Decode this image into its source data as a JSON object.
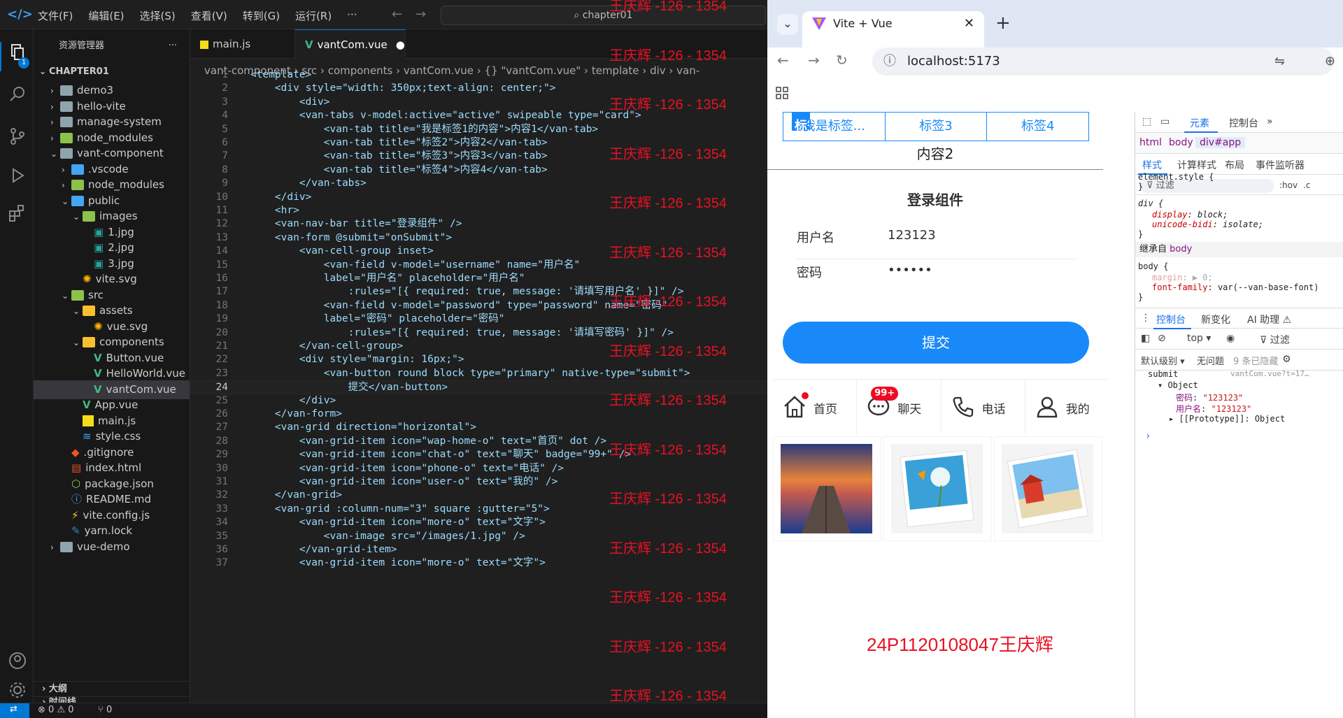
{
  "vscode": {
    "menus": [
      "文件(F)",
      "编辑(E)",
      "选择(S)",
      "查看(V)",
      "转到(G)",
      "运行(R)",
      "···"
    ],
    "search_text": "chapter01",
    "explorer_title": "资源管理器",
    "explorer_badge": "1",
    "root_folder": "CHAPTER01",
    "tree": [
      {
        "label": "demo3",
        "kind": "folder",
        "depth": 1,
        "open": false
      },
      {
        "label": "hello-vite",
        "kind": "folder",
        "depth": 1,
        "open": false
      },
      {
        "label": "manage-system",
        "kind": "folder",
        "depth": 1,
        "open": false
      },
      {
        "label": "node_modules",
        "kind": "folder-g",
        "depth": 1,
        "open": false
      },
      {
        "label": "vant-component",
        "kind": "folder",
        "depth": 1,
        "open": true
      },
      {
        "label": ".vscode",
        "kind": "folder-b",
        "depth": 2,
        "open": false
      },
      {
        "label": "node_modules",
        "kind": "folder-g",
        "depth": 2,
        "open": false
      },
      {
        "label": "public",
        "kind": "folder-b",
        "depth": 2,
        "open": true
      },
      {
        "label": "images",
        "kind": "folder-g",
        "depth": 3,
        "open": true
      },
      {
        "label": "1.jpg",
        "kind": "img",
        "depth": 4
      },
      {
        "label": "2.jpg",
        "kind": "img",
        "depth": 4
      },
      {
        "label": "3.jpg",
        "kind": "img",
        "depth": 4
      },
      {
        "label": "vite.svg",
        "kind": "svg",
        "depth": 3
      },
      {
        "label": "src",
        "kind": "folder-g",
        "depth": 2,
        "open": true
      },
      {
        "label": "assets",
        "kind": "folder-y",
        "depth": 3,
        "open": true
      },
      {
        "label": "vue.svg",
        "kind": "svg",
        "depth": 4
      },
      {
        "label": "components",
        "kind": "folder-y",
        "depth": 3,
        "open": true
      },
      {
        "label": "Button.vue",
        "kind": "vue",
        "depth": 4
      },
      {
        "label": "HelloWorld.vue",
        "kind": "vue",
        "depth": 4
      },
      {
        "label": "vantCom.vue",
        "kind": "vue",
        "depth": 4,
        "selected": true
      },
      {
        "label": "App.vue",
        "kind": "vue",
        "depth": 3
      },
      {
        "label": "main.js",
        "kind": "js",
        "depth": 3
      },
      {
        "label": "style.css",
        "kind": "css",
        "depth": 3
      },
      {
        "label": ".gitignore",
        "kind": "git",
        "depth": 2
      },
      {
        "label": "index.html",
        "kind": "html",
        "depth": 2
      },
      {
        "label": "package.json",
        "kind": "json",
        "depth": 2
      },
      {
        "label": "README.md",
        "kind": "info",
        "depth": 2
      },
      {
        "label": "vite.config.js",
        "kind": "vite",
        "depth": 2
      },
      {
        "label": "yarn.lock",
        "kind": "yarn",
        "depth": 2
      },
      {
        "label": "vue-demo",
        "kind": "folder",
        "depth": 1,
        "open": false
      }
    ],
    "outline_label": "大纲",
    "timeline_label": "时间线",
    "tabs": [
      {
        "label": "main.js"
      },
      {
        "label": "vantCom.vue",
        "active": true
      }
    ],
    "breadcrumb": "vant-component › src › components › vantCom.vue › {} \"vantCom.vue\" › template › div › van-",
    "code_lines": [
      "<template>",
      "    <div style=\"width: 350px;text-align: center;\">",
      "        <div>",
      "        <van-tabs v-model:active=\"active\" swipeable type=\"card\">",
      "            <van-tab title=\"我是标签1的内容\">内容1</van-tab>",
      "            <van-tab title=\"标签2\">内容2</van-tab>",
      "            <van-tab title=\"标签3\">内容3</van-tab>",
      "            <van-tab title=\"标签4\">内容4</van-tab>",
      "        </van-tabs>",
      "    </div>",
      "    <hr>",
      "    <van-nav-bar title=\"登录组件\" />",
      "    <van-form @submit=\"onSubmit\">",
      "        <van-cell-group inset>",
      "            <van-field v-model=\"username\" name=\"用户名\"",
      "            label=\"用户名\" placeholder=\"用户名\"",
      "                :rules=\"[{ required: true, message: '请填写用户名' }]\" />",
      "            <van-field v-model=\"password\" type=\"password\" name=\"密码\"",
      "            label=\"密码\" placeholder=\"密码\"",
      "                :rules=\"[{ required: true, message: '请填写密码' }]\" />",
      "        </van-cell-group>",
      "        <div style=\"margin: 16px;\">",
      "            <van-button round block type=\"primary\" native-type=\"submit\">",
      "                提交</van-button>",
      "        </div>",
      "    </van-form>",
      "    <van-grid direction=\"horizontal\">",
      "        <van-grid-item icon=\"wap-home-o\" text=\"首页\" dot />",
      "        <van-grid-item icon=\"chat-o\" text=\"聊天\" badge=\"99+\" />",
      "        <van-grid-item icon=\"phone-o\" text=\"电话\" />",
      "        <van-grid-item icon=\"user-o\" text=\"我的\" />",
      "    </van-grid>",
      "    <van-grid :column-num=\"3\" square :gutter=\"5\">",
      "        <van-grid-item icon=\"more-o\" text=\"文字\">",
      "            <van-image src=\"/images/1.jpg\" />",
      "        </van-grid-item>",
      "        <van-grid-item icon=\"more-o\" text=\"文字\">"
    ],
    "current_line": 24,
    "watermark": "王庆辉 -126 - 1354",
    "status": {
      "errors": "0",
      "warnings": "0",
      "ports": "0"
    }
  },
  "browser": {
    "tab_title": "Vite + Vue",
    "url": "localhost:5173",
    "app": {
      "tabs": [
        "我是标签...",
        "标签2",
        "标签3",
        "标签4"
      ],
      "active_tab": 1,
      "content": "内容2",
      "nav_title": "登录组件",
      "username_label": "用户名",
      "username_value": "123123",
      "password_label": "密码",
      "password_value": "••••••",
      "submit_label": "提交",
      "grid": [
        {
          "text": "首页",
          "icon": "home-icon"
        },
        {
          "text": "聊天",
          "icon": "chat-icon",
          "badge": "99+"
        },
        {
          "text": "电话",
          "icon": "phone-icon"
        },
        {
          "text": "我的",
          "icon": "user-icon"
        }
      ],
      "signature": "24P1120108047王庆辉"
    },
    "devtools": {
      "tabs": [
        "元素",
        "控制台"
      ],
      "dom_path": [
        "html",
        "body",
        "div#app"
      ],
      "subtabs": [
        "样式",
        "计算样式",
        "布局",
        "事件监听器"
      ],
      "filter_placeholder": "过滤",
      "hov": ":hov",
      "cls": ".c",
      "element_style": "element.style {",
      "close_brace": "}",
      "div_rule": "div {",
      "display_prop": "display",
      "display_val": "block;",
      "unicode_prop": "unicode-bidi",
      "unicode_val": "isolate;",
      "inherited_label": "继承自",
      "inherited_from": "body",
      "body_rule": "body {",
      "margin_prop": "margin",
      "margin_val": "▶ 0;",
      "ff_prop": "font-family",
      "ff_val": "var(--van-base-font)",
      "drawer_tabs": [
        "控制台",
        "新变化",
        "AI 助理 ⚠"
      ],
      "context": "top ▾",
      "console_filter": "过滤",
      "level": "默认级别 ▾",
      "no_issues": "无问题",
      "hidden": "9 条已隐藏",
      "log_label": "submit",
      "log_source": "vantCom.vue?t=17…",
      "obj_label": "▾ Object",
      "pw_key": "密码",
      "pw_val": "\"123123\"",
      "user_key": "用户名",
      "user_val": "\"123123\"",
      "proto": "▸ [[Prototype]]: Object",
      "prompt": "›"
    }
  }
}
